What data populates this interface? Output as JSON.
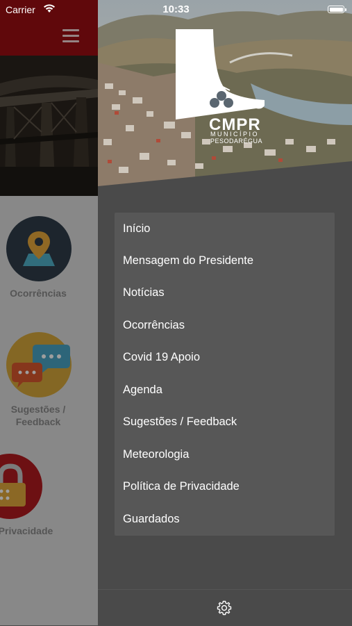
{
  "status_bar": {
    "carrier": "Carrier",
    "time": "10:33"
  },
  "main_app": {
    "tiles": [
      {
        "icon": "map-pin-icon",
        "label": "Ocorrências",
        "color": "#2f3d4a"
      },
      {
        "icon": "chat-bubbles-icon",
        "label": "Sugestões / Feedback",
        "color": "#d6a73a"
      },
      {
        "icon": "padlock-icon",
        "label": "e Privacidade",
        "color": "#b01a1f"
      }
    ]
  },
  "drawer": {
    "logo": {
      "wordmark": "CMPR",
      "line1": "MUNICÍPIO",
      "line2": "PESODARÉGUA"
    },
    "menu_items": [
      "Início",
      "Mensagem do Presidente",
      "Notícias",
      "Ocorrências",
      "Covid 19 Apoio",
      "Agenda",
      "Sugestões / Feedback",
      "Meteorologia",
      "Política de Privacidade",
      "Guardados"
    ],
    "footer_icon": "gear-icon"
  },
  "colors": {
    "header_red": "#9b0d12",
    "drawer_bg": "#4a4a4a",
    "menu_card_bg": "#575757"
  }
}
